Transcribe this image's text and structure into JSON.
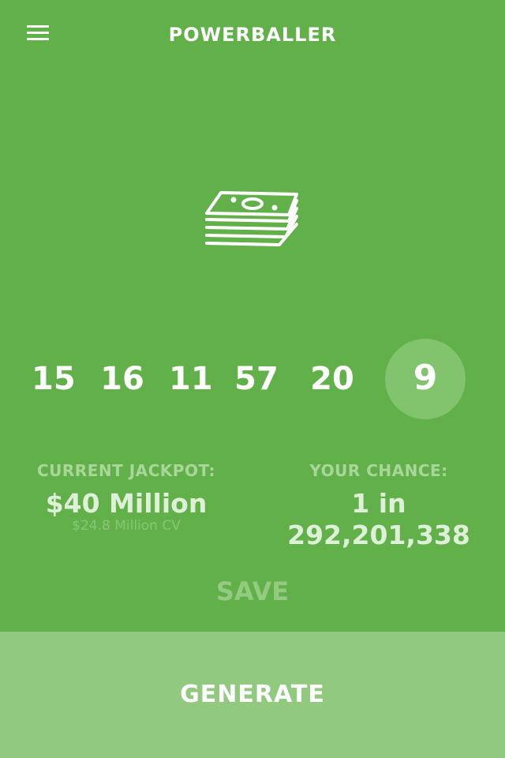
{
  "header": {
    "title": "POWERBALLER",
    "menu_icon": "hamburger-menu-icon"
  },
  "hero": {
    "icon": "money-stack-icon"
  },
  "numbers": {
    "white_balls": [
      "15",
      "16",
      "11",
      "57",
      "20"
    ],
    "power_ball": "9"
  },
  "jackpot": {
    "label": "CURRENT JACKPOT:",
    "value": "$40 Million",
    "cash_value": "$24.8 Million CV"
  },
  "chance": {
    "label": "YOUR CHANCE:",
    "value": "1 in 292,201,338"
  },
  "actions": {
    "save_label": "SAVE",
    "generate_label": "GENERATE"
  },
  "colors": {
    "background": "#62b04a",
    "power_ball_bg": "#82c46e",
    "generate_bg": "#91c97f",
    "text": "#ffffff"
  }
}
